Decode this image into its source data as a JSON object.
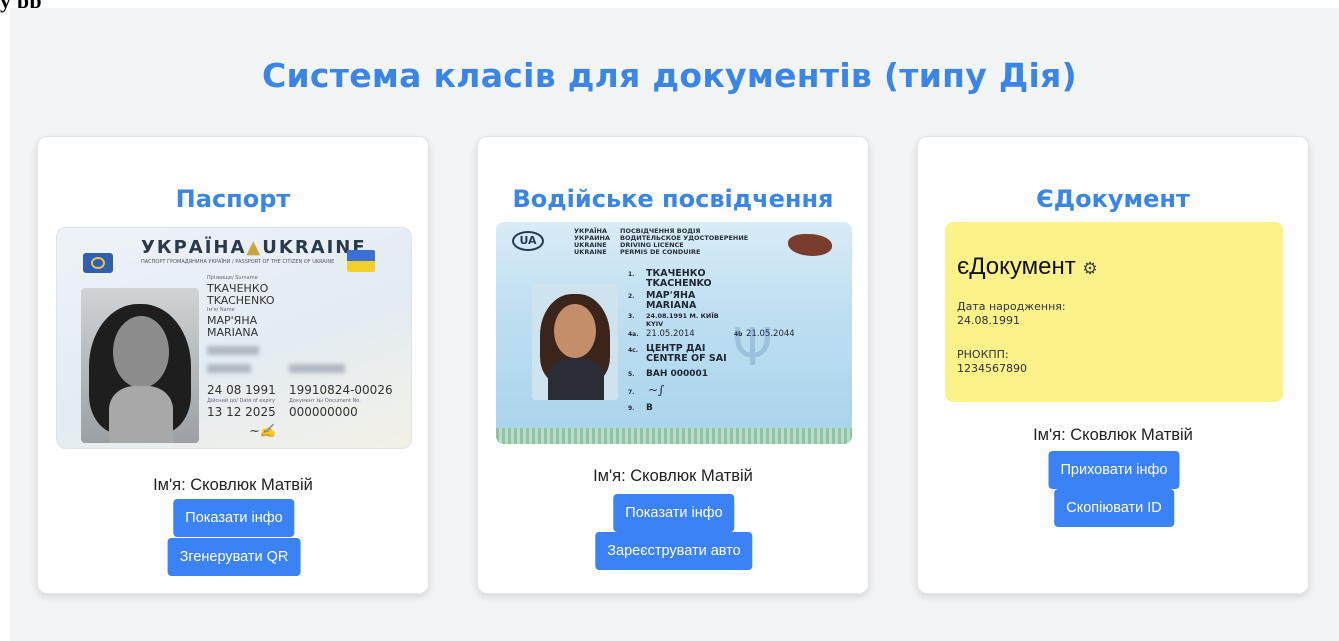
{
  "caption": "у                                     рр",
  "page": {
    "title": "Система класів для документів (типу Дія)"
  },
  "cards": [
    {
      "title": "Паспорт",
      "name": "Ім'я: Сковлюк Матвій",
      "buttons": [
        "Показати інфо",
        "Згенерувати QR"
      ],
      "image": {
        "country_line": "УКРАЇНА",
        "country_line_en": "UKRAINE",
        "subtitle": "ПАСПОРТ ГРОМАДЯНИНА УКРАЇНИ / PASSPORT OF THE CITIZEN OF UKRAINE",
        "surname_label": "Прізвище/ Surname",
        "surname_uk": "ТКАЧЕНКО",
        "surname_en": "TKACHENKO",
        "given_label": "Ім'я/ Name",
        "given_uk": "МАР'ЯНА",
        "given_en": "MARIANA",
        "birth_date": "24 08 1991",
        "record_no": "19910824-00026",
        "expiry_label": "Дійсний до/ Date of expiry",
        "docno_label": "Документ №/ Document No.",
        "expiry": "13 12 2025",
        "doc_no": "000000000"
      }
    },
    {
      "title": "Водійське посвідчення",
      "name": "Ім'я: Сковлюк Матвій",
      "buttons": [
        "Показати інфо",
        "Зареєструвати авто"
      ],
      "image": {
        "ua_badge": "UA",
        "header_l1": "УКРАЇНА",
        "header_l2": "УКРАИНА",
        "header_l3": "UKRAINE",
        "header_l4": "UKRAINE",
        "header_r1": "ПОСВІДЧЕННЯ ВОДІЯ",
        "header_r2": "ВОДИТЕЛЬСКОЕ УДОСТОВЕРЕНИЕ",
        "header_r3": "DRIVING LICENCE",
        "header_r4": "PERMIS DE CONDUIRE",
        "f1": "ТКАЧЕНКО",
        "f1b": "TKACHENKO",
        "f2": "МАР'ЯНА",
        "f2b": "MARIANA",
        "f3": "24.08.1991 М. КИЇВ",
        "f3b": "KYIV",
        "f4a": "21.05.2014",
        "f4b": "21.05.2044",
        "f4c1": "ЦЕНТР ДАІ",
        "f4c2": "CENTRE OF SAI",
        "f5": "ВАН 000001",
        "f9": "B",
        "n1": "1.",
        "n2": "2.",
        "n3": "3.",
        "n4a": "4a.",
        "n4b": "4b",
        "n4c": "4c.",
        "n5": "5.",
        "n7": "7.",
        "n9": "9."
      }
    },
    {
      "title": "ЄДокумент",
      "name": "Ім'я: Сковлюк Матвій",
      "buttons": [
        "Приховати інфо",
        "Скопіювати ID"
      ],
      "image": {
        "heading": "єДокумент",
        "birth_label": "Дата народження:",
        "birth_value": "24.08.1991",
        "tax_label": "РНОКПП:",
        "tax_value": "1234567890"
      }
    }
  ],
  "colors": {
    "accent": "#3a86e8",
    "button": "#3b82f6",
    "background": "#f3f4f6",
    "edoc_yellow": "#fbf28a"
  }
}
